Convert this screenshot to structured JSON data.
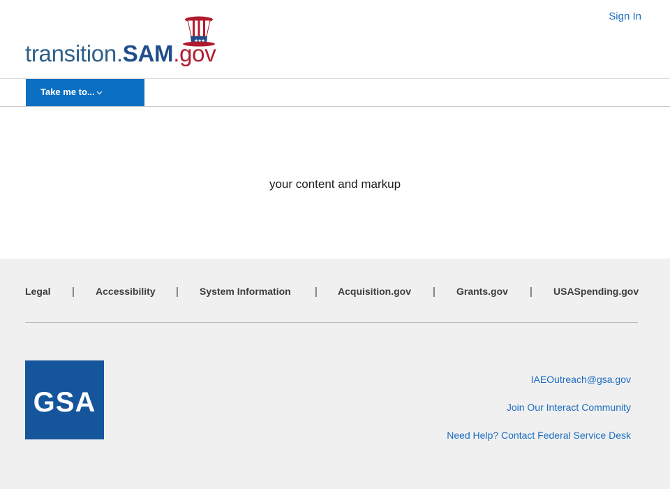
{
  "header": {
    "logo": {
      "part1": "transition.",
      "part2": "SAM",
      "part3": ".gov"
    },
    "sign_in": "Sign In"
  },
  "nav": {
    "take_me_to": "Take me to..."
  },
  "main": {
    "content": "your content and markup"
  },
  "footer": {
    "links": [
      "Legal",
      "Accessibility",
      "System Information",
      "Acquisition.gov",
      "Grants.gov",
      "USASpending.gov"
    ],
    "separator": "|",
    "gsa_logo_text": "GSA",
    "contacts": {
      "email": "IAEOutreach@gsa.gov",
      "interact": "Join Our Interact Community",
      "help": "Need Help? Contact Federal Service Desk"
    }
  },
  "colors": {
    "link_blue": "#1a6cbf",
    "nav_button_blue": "#0b70c2",
    "gsa_blue": "#14559c",
    "footer_bg": "#f0f0f0"
  }
}
